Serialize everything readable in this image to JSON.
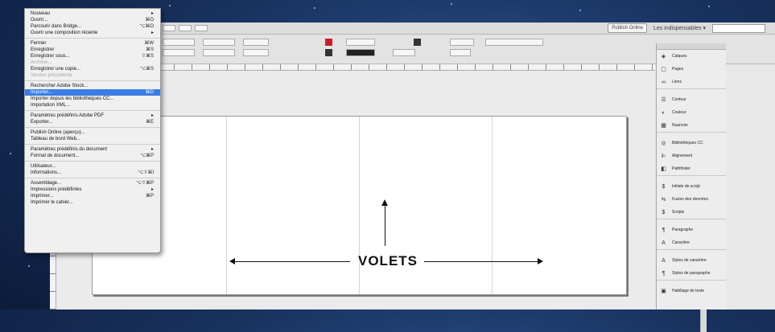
{
  "topbar": {
    "publish_label": "Publish Online",
    "workspace_label": "Les indispensables",
    "workspace_chevron": "▾"
  },
  "menu": {
    "items": [
      {
        "label": "Nouveau",
        "shortcut": "▸",
        "disabled": false,
        "highlight": false
      },
      {
        "label": "Ouvrir...",
        "shortcut": "⌘O",
        "disabled": false,
        "highlight": false
      },
      {
        "label": "Parcourir dans Bridge...",
        "shortcut": "⌥⌘O",
        "disabled": false,
        "highlight": false
      },
      {
        "label": "Ouvrir une composition récente",
        "shortcut": "▸",
        "disabled": false,
        "highlight": false
      },
      {
        "sep": true
      },
      {
        "label": "Fermer",
        "shortcut": "⌘W",
        "disabled": false,
        "highlight": false
      },
      {
        "label": "Enregistrer",
        "shortcut": "⌘S",
        "disabled": false,
        "highlight": false
      },
      {
        "label": "Enregistrer sous...",
        "shortcut": "⇧⌘S",
        "disabled": false,
        "highlight": false
      },
      {
        "label": "Archiver...",
        "shortcut": "",
        "disabled": true,
        "highlight": false
      },
      {
        "label": "Enregistrer une copie...",
        "shortcut": "⌥⌘S",
        "disabled": false,
        "highlight": false
      },
      {
        "label": "Version précédente",
        "shortcut": "",
        "disabled": true,
        "highlight": false
      },
      {
        "sep": true
      },
      {
        "label": "Rechercher Adobe Stock...",
        "shortcut": "",
        "disabled": false,
        "highlight": false
      },
      {
        "label": "Importer...",
        "shortcut": "⌘D",
        "disabled": false,
        "highlight": true
      },
      {
        "label": "Importer depuis les bibliothèques CC...",
        "shortcut": "",
        "disabled": false,
        "highlight": false
      },
      {
        "label": "Importation XML...",
        "shortcut": "",
        "disabled": false,
        "highlight": false
      },
      {
        "sep": true
      },
      {
        "label": "Paramètres prédéfinis Adobe PDF",
        "shortcut": "▸",
        "disabled": false,
        "highlight": false
      },
      {
        "label": "Exporter...",
        "shortcut": "⌘E",
        "disabled": false,
        "highlight": false
      },
      {
        "sep": true
      },
      {
        "label": "Publish Online (aperçu)...",
        "shortcut": "",
        "disabled": false,
        "highlight": false
      },
      {
        "label": "Tableau de bord Web...",
        "shortcut": "",
        "disabled": false,
        "highlight": false
      },
      {
        "sep": true
      },
      {
        "label": "Paramètres prédéfinis du document",
        "shortcut": "▸",
        "disabled": false,
        "highlight": false
      },
      {
        "label": "Format de document...",
        "shortcut": "⌥⌘P",
        "disabled": false,
        "highlight": false
      },
      {
        "sep": true
      },
      {
        "label": "Utilisateur...",
        "shortcut": "",
        "disabled": false,
        "highlight": false
      },
      {
        "label": "Informations...",
        "shortcut": "⌥⇧⌘I",
        "disabled": false,
        "highlight": false
      },
      {
        "sep": true
      },
      {
        "label": "Assemblage...",
        "shortcut": "⌥⇧⌘P",
        "disabled": false,
        "highlight": false
      },
      {
        "label": "Impressions prédéfinies",
        "shortcut": "▸",
        "disabled": false,
        "highlight": false
      },
      {
        "label": "Imprimer...",
        "shortcut": "⌘P",
        "disabled": false,
        "highlight": false
      },
      {
        "label": "Imprimer le cahier...",
        "shortcut": "",
        "disabled": false,
        "highlight": false
      }
    ]
  },
  "panel": {
    "groups": [
      [
        {
          "label": "Calques",
          "icon": "layers-icon",
          "glyph": "◈"
        },
        {
          "label": "Pages",
          "icon": "pages-icon",
          "glyph": "▢"
        },
        {
          "label": "Liens",
          "icon": "links-icon",
          "glyph": "∞"
        }
      ],
      [
        {
          "label": "Contour",
          "icon": "stroke-icon",
          "glyph": "☰"
        },
        {
          "label": "Couleur",
          "icon": "color-icon",
          "glyph": "◐"
        },
        {
          "label": "Nuancier",
          "icon": "swatches-icon",
          "glyph": "▦"
        }
      ],
      [
        {
          "label": "Bibliothèques CC",
          "icon": "cc-libraries-icon",
          "glyph": "◎"
        },
        {
          "label": "Alignement",
          "icon": "align-icon",
          "glyph": "⊫"
        },
        {
          "label": "Pathfinder",
          "icon": "pathfinder-icon",
          "glyph": "◧"
        }
      ],
      [
        {
          "label": "Initiale de script",
          "icon": "script-label-icon",
          "glyph": "$"
        },
        {
          "label": "Fusion des données",
          "icon": "data-merge-icon",
          "glyph": "⇆"
        },
        {
          "label": "Scripts",
          "icon": "scripts-icon",
          "glyph": "$"
        }
      ],
      [
        {
          "label": "Paragraphe",
          "icon": "paragraph-icon",
          "glyph": "¶"
        },
        {
          "label": "Caractère",
          "icon": "character-icon",
          "glyph": "A"
        }
      ],
      [
        {
          "label": "Styles de caractère",
          "icon": "character-styles-icon",
          "glyph": "A"
        },
        {
          "label": "Styles de paragraphe",
          "icon": "paragraph-styles-icon",
          "glyph": "¶"
        }
      ],
      [
        {
          "label": "Habillage de texte",
          "icon": "text-wrap-icon",
          "glyph": "▣"
        }
      ]
    ]
  },
  "annotation": {
    "label": "VOLETS",
    "color": "#111111"
  }
}
